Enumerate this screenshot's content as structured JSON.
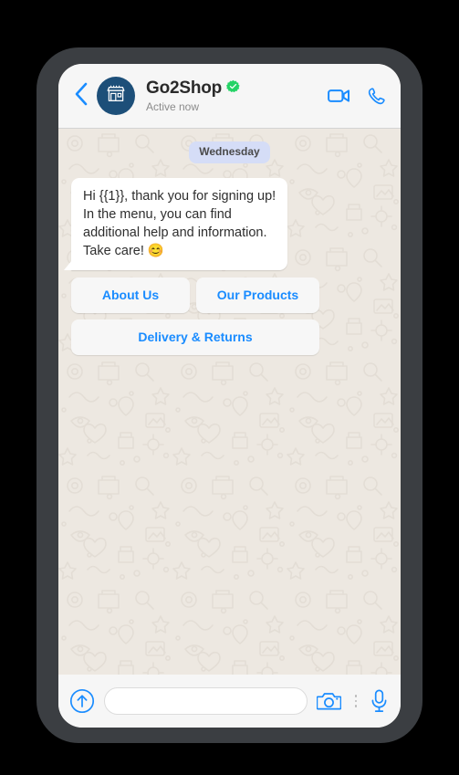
{
  "device": {
    "frame_color": "#3B3E42",
    "canvas_color": "#000000"
  },
  "header": {
    "back_icon": "chevron-left-icon",
    "avatar_icon": "storefront-icon",
    "avatar_color": "#1D4F79",
    "title": "Go2Shop",
    "verified_badge": "verified-badge-icon",
    "verified_color": "#25D366",
    "status": "Active now",
    "actions": [
      {
        "name": "video-call-icon",
        "label": "Video call"
      },
      {
        "name": "voice-call-icon",
        "label": "Voice call"
      }
    ],
    "accent_color": "#1A8CFF",
    "background": "#F6F6F6"
  },
  "chat": {
    "background": "#EDE8E1",
    "doodle_color": "#E3DDD5",
    "date_divider": "Wednesday",
    "date_pill_color": "#D5DDF7",
    "message": {
      "text": "Hi {{1}}, thank you for signing up!\nIn the menu, you can find\nadditional help and information.\nTake care! 😊",
      "bubble_color": "#FFFFFF",
      "sender": "incoming"
    },
    "quick_replies": [
      {
        "label": "About Us"
      },
      {
        "label": "Our Products"
      },
      {
        "label": "Delivery & Returns"
      }
    ],
    "quick_reply_text_color": "#1A8CFF"
  },
  "composer": {
    "send_icon": "arrow-up-circle-icon",
    "input_value": "",
    "input_placeholder": "",
    "camera_icon": "camera-icon",
    "menu_icon": "kebab-menu-icon",
    "mic_icon": "microphone-icon",
    "background": "#F6F6F6"
  }
}
